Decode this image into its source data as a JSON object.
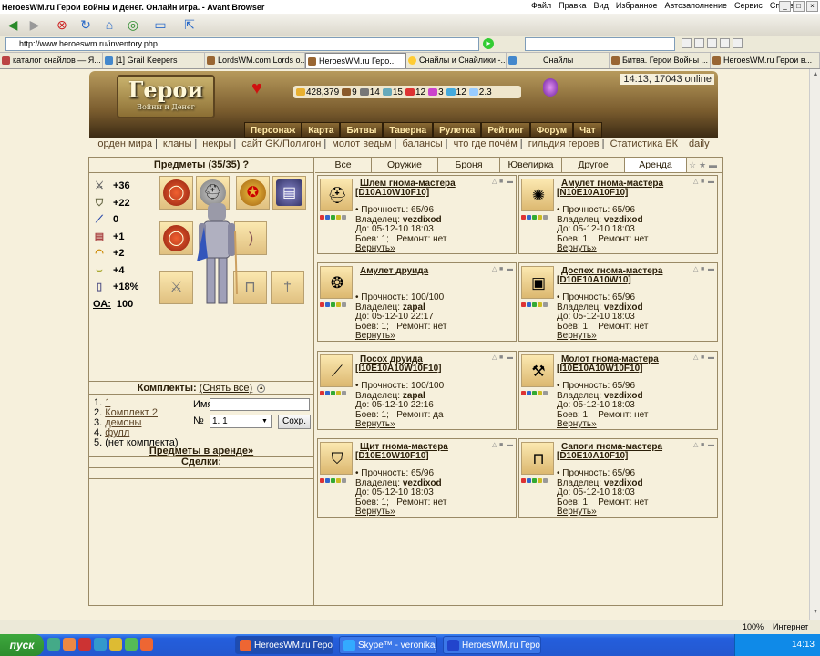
{
  "window": {
    "title": "HeroesWM.ru Герои войны и денег. Онлайн игра. - Avant Browser",
    "menu": [
      "Файл",
      "Правка",
      "Вид",
      "Избранное",
      "Автозаполнение",
      "Сервис",
      "Справка"
    ]
  },
  "address": {
    "url": "http://www.heroeswm.ru/inventory.php"
  },
  "tabs": [
    "каталог снайлов — Я...",
    "[1] Grail Keepers",
    "LordsWM.com Lords o...",
    "HeroesWM.ru Геро...",
    "Снайлы и Снайлики -...",
    "Снайлы",
    "Битва. Герои Войны ...",
    "HeroesWM.ru Герои в..."
  ],
  "game": {
    "logo": "Герои",
    "logo_sub": "Войны и Денег",
    "clock": "14:13, 17043 online",
    "resources": [
      "428,379",
      "9",
      "14",
      "15",
      "12",
      "3",
      "12",
      "2.3"
    ],
    "nav": [
      "Персонаж",
      "Карта",
      "Битвы",
      "Таверна",
      "Рулетка",
      "Рейтинг",
      "Форум",
      "Чат"
    ],
    "links": [
      "орден мира",
      "кланы",
      "некры",
      "сайт GK/Полигон",
      "молот ведьм",
      "балансы",
      "что где почём",
      "гильдия героев",
      "Статистика БК",
      "daily"
    ]
  },
  "left": {
    "items_title": "Предметы (35/35)",
    "help": "?",
    "stats": [
      {
        "icon": "sword-icon",
        "value": "+36"
      },
      {
        "icon": "shield-icon",
        "value": "+22"
      },
      {
        "icon": "wand-icon",
        "value": "0"
      },
      {
        "icon": "book-icon",
        "value": "+1"
      },
      {
        "icon": "rainbow-icon",
        "value": "+2"
      },
      {
        "icon": "bow-icon",
        "value": "+4"
      },
      {
        "icon": "potion-icon",
        "value": "+18%"
      }
    ],
    "oa_label": "ОА:",
    "oa_value": "100",
    "komplekty_label": "Комплекты:",
    "komplekty_link": "(Снять все)",
    "komplekty": [
      "1",
      "Комплект 2",
      "демоны",
      "фулл",
      "(нет комплекта)"
    ],
    "form": {
      "name_label": "Имя",
      "num_label": "№",
      "select_value": "1. 1",
      "save": "Сохр."
    },
    "arena_link": "Предметы в аренде»",
    "deals": "Сделки:"
  },
  "right": {
    "tabs": [
      "Все",
      "Оружие",
      "Броня",
      "Ювелирка",
      "Другое",
      "Аренда"
    ],
    "cards": [
      {
        "name": "Шлем гнома-мастера",
        "code": "[D10A10W10F10]",
        "durability": "Прочность: 65/96",
        "owner_label": "Владелец:",
        "owner": "vezdixod",
        "until": "До: 05-12-10 18:03",
        "battles": "Боев: 1;",
        "repair": "Ремонт: нет",
        "return": "Вернуть»",
        "glyph": "⛑"
      },
      {
        "name": "Амулет гнома-мастера",
        "code": "[N10E10A10F10]",
        "durability": "Прочность: 65/96",
        "owner_label": "Владелец:",
        "owner": "vezdixod",
        "until": "До: 05-12-10 18:03",
        "battles": "Боев: 1;",
        "repair": "Ремонт: нет",
        "return": "Вернуть»",
        "glyph": "✺"
      },
      {
        "name": "Амулет друида",
        "code": "",
        "durability": "Прочность: 100/100",
        "owner_label": "Владелец:",
        "owner": "zapal",
        "until": "До: 05-12-10 22:17",
        "battles": "Боев: 1;",
        "repair": "Ремонт: нет",
        "return": "Вернуть»",
        "glyph": "❂"
      },
      {
        "name": "Доспех гнома-мастера",
        "code": "[D10E10A10W10]",
        "durability": "Прочность: 65/96",
        "owner_label": "Владелец:",
        "owner": "vezdixod",
        "until": "До: 05-12-10 18:03",
        "battles": "Боев: 1;",
        "repair": "Ремонт: нет",
        "return": "Вернуть»",
        "glyph": "▣"
      },
      {
        "name": "Посох друида",
        "code": "[I10E10A10W10F10]",
        "durability": "Прочность: 100/100",
        "owner_label": "Владелец:",
        "owner": "zapal",
        "until": "До: 05-12-10 22:16",
        "battles": "Боев: 1;",
        "repair": "Ремонт: да",
        "return": "Вернуть»",
        "glyph": "⟋"
      },
      {
        "name": "Молот гнома-мастера",
        "code": "[I10E10A10W10F10]",
        "durability": "Прочность: 65/96",
        "owner_label": "Владелец:",
        "owner": "vezdixod",
        "until": "До: 05-12-10 18:03",
        "battles": "Боев: 1;",
        "repair": "Ремонт: нет",
        "return": "Вернуть»",
        "glyph": "⚒"
      },
      {
        "name": "Щит гнома-мастера",
        "code": "[D10E10W10F10]",
        "durability": "Прочность: 65/96",
        "owner_label": "Владелец:",
        "owner": "vezdixod",
        "until": "До: 05-12-10 18:03",
        "battles": "Боев: 1;",
        "repair": "Ремонт: нет",
        "return": "Вернуть»",
        "glyph": "⛉"
      },
      {
        "name": "Сапоги гнома-мастера",
        "code": "[D10E10A10F10]",
        "durability": "Прочность: 65/96",
        "owner_label": "Владелец:",
        "owner": "vezdixod",
        "until": "До: 05-12-10 18:03",
        "battles": "Боев: 1;",
        "repair": "Ремонт: нет",
        "return": "Вернуть»",
        "glyph": "⊓"
      }
    ]
  },
  "status": {
    "zoom": "100%",
    "zone": "Интернет"
  },
  "taskbar": {
    "start": "пуск",
    "tasks": [
      "HeroesWM.ru Геро...",
      "Skype™ - veronika_...",
      "HeroesWM.ru Геро..."
    ],
    "clock": "14:13"
  }
}
